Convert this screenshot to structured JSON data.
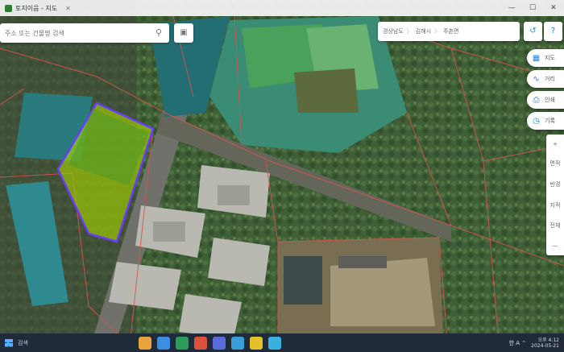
{
  "browser": {
    "tab_title": "토지이음 - 지도",
    "close_glyph": "✕",
    "window_controls": [
      "—",
      "☐",
      "✕"
    ]
  },
  "search": {
    "placeholder": "주소 또는 건물명 검색",
    "icon": "search-icon",
    "side_icon": "bookmark-icon"
  },
  "location": {
    "crumbs": [
      "경상남도",
      "김해시",
      "주촌면"
    ],
    "separator": "〉",
    "buttons": [
      "share-icon",
      "help-icon"
    ]
  },
  "tools": [
    {
      "icon": "layers-icon",
      "label": "지도"
    },
    {
      "icon": "measure-icon",
      "label": "거리"
    },
    {
      "icon": "print-icon",
      "label": "인쇄"
    },
    {
      "icon": "history-icon",
      "label": "기록"
    }
  ],
  "vbar": [
    "+",
    "면적",
    "반경",
    "지적",
    "전체",
    "—"
  ],
  "taskbar": {
    "search_text": "검색",
    "tray_text": "한  A  ⌃",
    "time": "오후 4:12",
    "date": "2024-05-21"
  },
  "colors": {
    "parcel_outline": "#d9534f",
    "selection": "#6a3cff",
    "selection_fill": "#a7d400",
    "roof": "#2a7b7e"
  }
}
